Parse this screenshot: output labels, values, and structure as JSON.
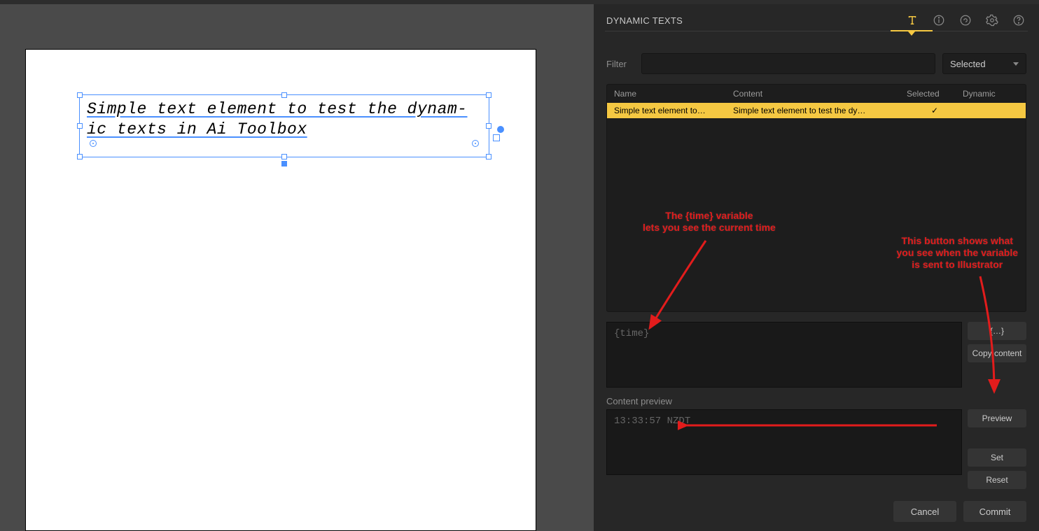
{
  "canvas": {
    "text": "Simple text element to test the dynam-\nic texts in Ai Toolbox"
  },
  "panel": {
    "title": "DYNAMIC TEXTS",
    "filter_label": "Filter",
    "filter_value": "",
    "filter_placeholder": "",
    "filter_mode": "Selected",
    "columns": {
      "name": "Name",
      "content": "Content",
      "selected": "Selected",
      "dynamic": "Dynamic"
    },
    "rows": [
      {
        "name": "Simple text element to…",
        "content": "Simple text element to test the dy…",
        "selected": "✓",
        "dynamic": ""
      }
    ],
    "editor_value": "{time}",
    "variables_btn": "{…}",
    "copy_btn": "Copy content",
    "preview_label": "Content preview",
    "preview_value": "13:33:57 NZDT",
    "preview_btn": "Preview",
    "set_btn": "Set",
    "reset_btn": "Reset",
    "cancel_btn": "Cancel",
    "commit_btn": "Commit"
  },
  "annotations": {
    "time_var": "The {time} variable\nlets you see the current time",
    "preview_btn_note": "This button shows what\nyou see when the variable\nis sent to Illustrator"
  },
  "colors": {
    "accent": "#f5c842",
    "annotation": "#e21c1c",
    "selection": "#4a90ff"
  }
}
